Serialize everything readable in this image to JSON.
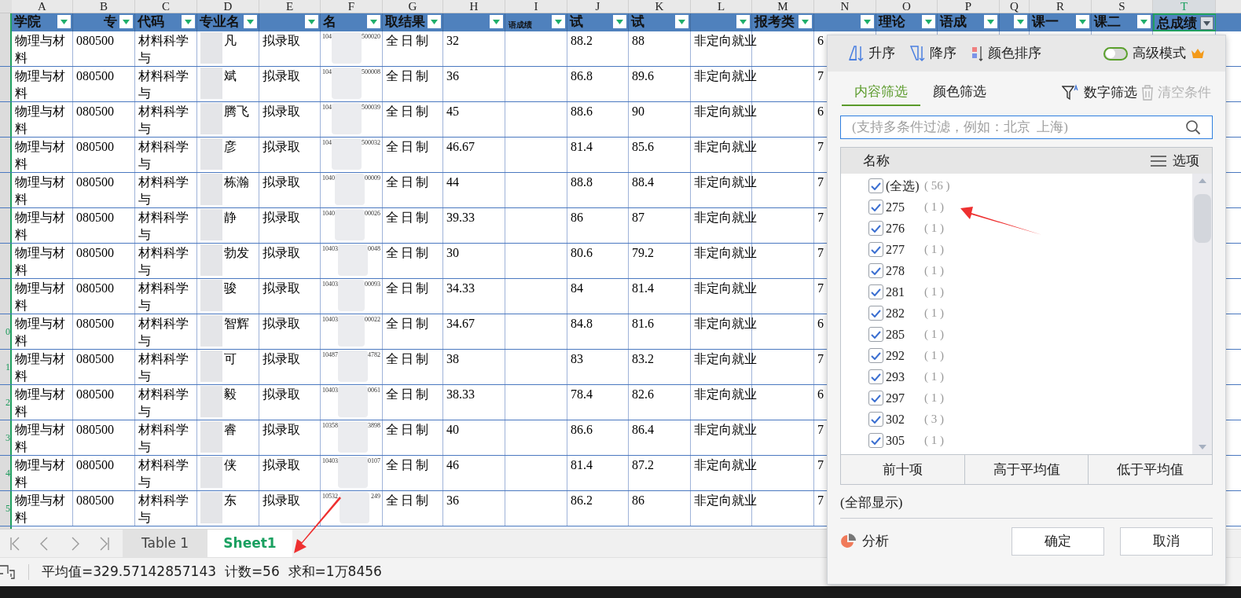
{
  "columns": [
    {
      "letter": "A",
      "header": "学院"
    },
    {
      "letter": "B",
      "header": "专"
    },
    {
      "letter": "C",
      "header": "代码"
    },
    {
      "letter": "D",
      "header": "专业名"
    },
    {
      "letter": "E"
    },
    {
      "letter": "F",
      "header": "名"
    },
    {
      "letter": "G",
      "header": "取结果"
    },
    {
      "letter": "H"
    },
    {
      "letter": "I",
      "header": "语成绩"
    },
    {
      "letter": "J",
      "header": "试"
    },
    {
      "letter": "K",
      "header": "试"
    },
    {
      "letter": "L"
    },
    {
      "letter": "M",
      "header": "报考类"
    },
    {
      "letter": "N"
    },
    {
      "letter": "O",
      "header": "理论"
    },
    {
      "letter": "P",
      "header": "语成"
    },
    {
      "letter": "Q"
    },
    {
      "letter": "R",
      "header": "课一"
    },
    {
      "letter": "S",
      "header": "课二"
    },
    {
      "letter": "T",
      "header": "总成绩",
      "selected": true
    }
  ],
  "rows": [
    {
      "a": "物理与材料",
      "b": "080500",
      "c": "材料科学与",
      "d": "凡",
      "e": "拟录取",
      "f": [
        "104",
        "500020"
      ],
      "g": "全日制",
      "h": "32",
      "j": "88.2",
      "k": "88",
      "l": "非定向就业",
      "n": "6"
    },
    {
      "a": "物理与材料",
      "b": "080500",
      "c": "材料科学与",
      "d": "斌",
      "e": "拟录取",
      "f": [
        "104",
        "500008"
      ],
      "g": "全日制",
      "h": "36",
      "j": "86.8",
      "k": "89.6",
      "l": "非定向就业",
      "n": "7"
    },
    {
      "a": "物理与材料",
      "b": "080500",
      "c": "材料科学与",
      "d": "腾飞",
      "e": "拟录取",
      "f": [
        "104",
        "500039"
      ],
      "g": "全日制",
      "h": "45",
      "j": "88.6",
      "k": "90",
      "l": "非定向就业",
      "n": "6"
    },
    {
      "a": "物理与材料",
      "b": "080500",
      "c": "材料科学与",
      "d": "彦",
      "e": "拟录取",
      "f": [
        "104",
        "500032"
      ],
      "g": "全日制",
      "h": "46.67",
      "j": "81.4",
      "k": "85.6",
      "l": "非定向就业",
      "n": "7"
    },
    {
      "a": "物理与材料",
      "b": "080500",
      "c": "材料科学与",
      "d": "栋瀚",
      "e": "拟录取",
      "f": [
        "1040",
        "00009"
      ],
      "g": "全日制",
      "h": "44",
      "j": "88.8",
      "k": "88.4",
      "l": "非定向就业",
      "n": "7"
    },
    {
      "a": "物理与材料",
      "b": "080500",
      "c": "材料科学与",
      "d": "静",
      "e": "拟录取",
      "f": [
        "1040",
        "00026"
      ],
      "g": "全日制",
      "h": "39.33",
      "j": "86",
      "k": "87",
      "l": "非定向就业",
      "n": "7"
    },
    {
      "a": "物理与材料",
      "b": "080500",
      "c": "材料科学与",
      "d": "勃发",
      "e": "拟录取",
      "f": [
        "10403",
        "0048"
      ],
      "g": "全日制",
      "h": "30",
      "j": "80.6",
      "k": "79.2",
      "l": "非定向就业",
      "n": "7"
    },
    {
      "a": "物理与材料",
      "b": "080500",
      "c": "材料科学与",
      "d": "骏",
      "e": "拟录取",
      "f": [
        "10403",
        "00093"
      ],
      "g": "全日制",
      "h": "34.33",
      "j": "84",
      "k": "81.4",
      "l": "非定向就业",
      "n": "7"
    },
    {
      "a": "物理与材料",
      "b": "080500",
      "c": "材料科学与",
      "d": "智辉",
      "e": "拟录取",
      "f": [
        "10403",
        "00022"
      ],
      "g": "全日制",
      "h": "34.67",
      "j": "84.8",
      "k": "81.6",
      "l": "非定向就业",
      "n": "6",
      "row_number": "0"
    },
    {
      "a": "物理与材料",
      "b": "080500",
      "c": "材料科学与",
      "d": "可",
      "e": "拟录取",
      "f": [
        "10487",
        "4782"
      ],
      "g": "全日制",
      "h": "38",
      "j": "83",
      "k": "83.2",
      "l": "非定向就业",
      "n": "7",
      "row_number": "1"
    },
    {
      "a": "物理与材料",
      "b": "080500",
      "c": "材料科学与",
      "d": "毅",
      "e": "拟录取",
      "f": [
        "10403",
        "0061"
      ],
      "g": "全日制",
      "h": "38.33",
      "j": "78.4",
      "k": "82.6",
      "l": "非定向就业",
      "n": "6",
      "row_number": "2"
    },
    {
      "a": "物理与材料",
      "b": "080500",
      "c": "材料科学与",
      "d": "睿",
      "e": "拟录取",
      "f": [
        "10358",
        "3898"
      ],
      "g": "全日制",
      "h": "40",
      "j": "86.6",
      "k": "86.4",
      "l": "非定向就业",
      "n": "7",
      "row_number": "3"
    },
    {
      "a": "物理与材料",
      "b": "080500",
      "c": "材料科学与",
      "d": "侠",
      "e": "拟录取",
      "f": [
        "10403",
        "0107"
      ],
      "g": "全日制",
      "h": "46",
      "j": "81.4",
      "k": "87.2",
      "l": "非定向就业",
      "n": "7",
      "row_number": "4"
    },
    {
      "a": "物理与材料",
      "b": "080500",
      "c": "材料科学与",
      "d": "东",
      "e": "拟录取",
      "f": [
        "10532",
        "249"
      ],
      "g": "全日制",
      "h": "36",
      "j": "86.2",
      "k": "86",
      "l": "非定向就业",
      "n": "7",
      "row_number": "5"
    }
  ],
  "sheet_tabs": [
    {
      "label": "Table 1",
      "selected": false
    },
    {
      "label": "Sheet1",
      "selected": true
    }
  ],
  "status_bar": "平均值=329.57142857143  计数=56  求和=1万8456",
  "filter_panel": {
    "sort_buttons": [
      {
        "kind": "ascending",
        "label": "升序"
      },
      {
        "kind": "descending",
        "label": "降序"
      },
      {
        "kind": "color",
        "label": "颜色排序"
      }
    ],
    "advanced_mode": {
      "label": "高级模式",
      "on": false
    },
    "tabs": [
      {
        "label": "内容筛选",
        "selected": true
      },
      {
        "label": "颜色筛选",
        "selected": false
      }
    ],
    "number_filter": "数字筛选",
    "clear_conditions": {
      "label": "清空条件",
      "disabled": true
    },
    "search": {
      "placeholder": "(支持多条件过滤，例如：北京  上海)"
    },
    "list_header": "名称",
    "options": "选项",
    "items": [
      {
        "label": "(全选)",
        "count": "( 56 )",
        "checked": true
      },
      {
        "label": "275",
        "count": "( 1 )",
        "checked": true
      },
      {
        "label": "276",
        "count": "( 1 )",
        "checked": true
      },
      {
        "label": "277",
        "count": "( 1 )",
        "checked": true
      },
      {
        "label": "278",
        "count": "( 1 )",
        "checked": true
      },
      {
        "label": "281",
        "count": "( 1 )",
        "checked": true
      },
      {
        "label": "282",
        "count": "( 1 )",
        "checked": true
      },
      {
        "label": "285",
        "count": "( 1 )",
        "checked": true
      },
      {
        "label": "292",
        "count": "( 1 )",
        "checked": true
      },
      {
        "label": "293",
        "count": "( 1 )",
        "checked": true
      },
      {
        "label": "297",
        "count": "( 1 )",
        "checked": true
      },
      {
        "label": "302",
        "count": "( 3 )",
        "checked": true
      },
      {
        "label": "305",
        "count": "( 1 )",
        "checked": true
      }
    ],
    "quick_buttons": [
      "前十项",
      "高于平均值",
      "低于平均值"
    ],
    "show_all": "(全部显示)",
    "analyze": "分析",
    "ok": "确定",
    "cancel": "取消"
  }
}
